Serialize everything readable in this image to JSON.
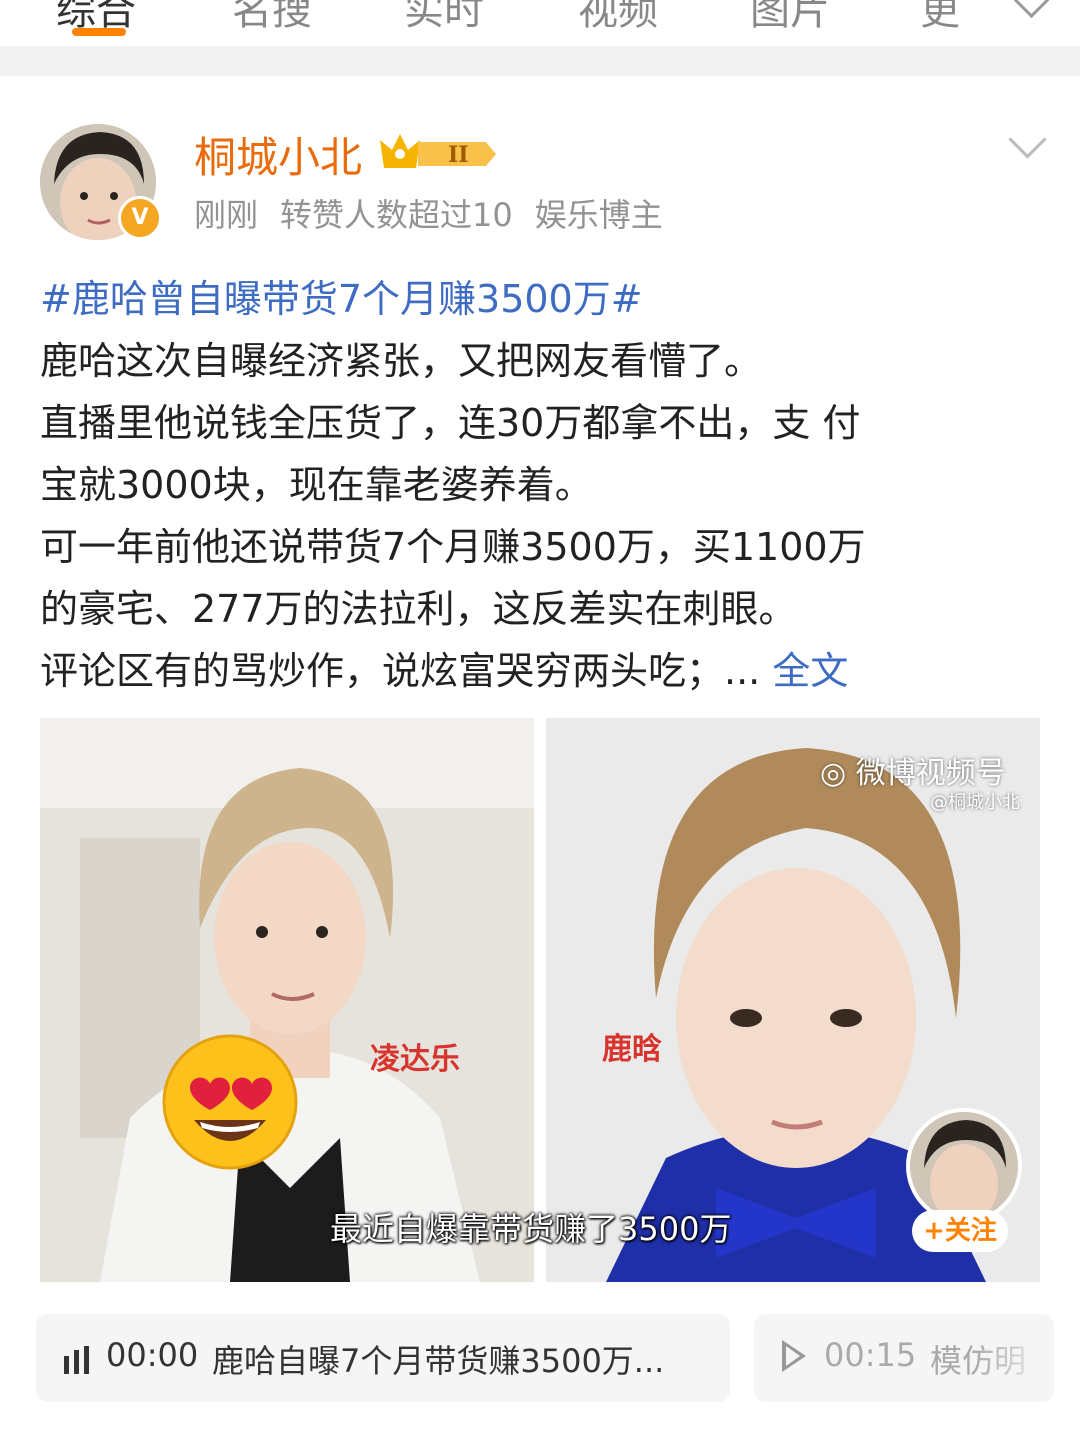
{
  "tabs": {
    "items": [
      {
        "label": "综合"
      },
      {
        "label": "名搜"
      },
      {
        "label": "实时"
      },
      {
        "label": "视频"
      },
      {
        "label": "图片"
      },
      {
        "label": "更"
      }
    ]
  },
  "post": {
    "author": {
      "name": "桐城小北",
      "level_badge": "II"
    },
    "meta": {
      "time": "刚刚",
      "reposts": "转赞人数超过10",
      "tag": "娱乐博主"
    },
    "topic": "#鹿哈曾自曝带货7个月赚3500万#",
    "lines": [
      "鹿哈这次自曝经济紧张，又把网友看懵了。",
      "直播里他说钱全压货了，连30万都拿不出，支 付",
      "宝就3000块，现在靠老婆养着。",
      "可一年前他还说带货7个月赚3500万，买1100万",
      "的豪宅、277万的法拉利，这反差实在刺眼。",
      "评论区有的骂炒作，说炫富哭穷两头吃；..."
    ],
    "more_link": "全文",
    "image": {
      "label_left": "凌达乐",
      "label_right": "鹿晗",
      "caption": "最近自爆靠带货赚了3500万",
      "watermark": "微博视频号",
      "watermark_sub": "@桐城小北",
      "follow": "+关注"
    },
    "audio": [
      {
        "time": "00:00",
        "title": "鹿哈自曝7个月带货赚3500万..."
      },
      {
        "time": "00:15",
        "title": "模仿明"
      }
    ]
  }
}
